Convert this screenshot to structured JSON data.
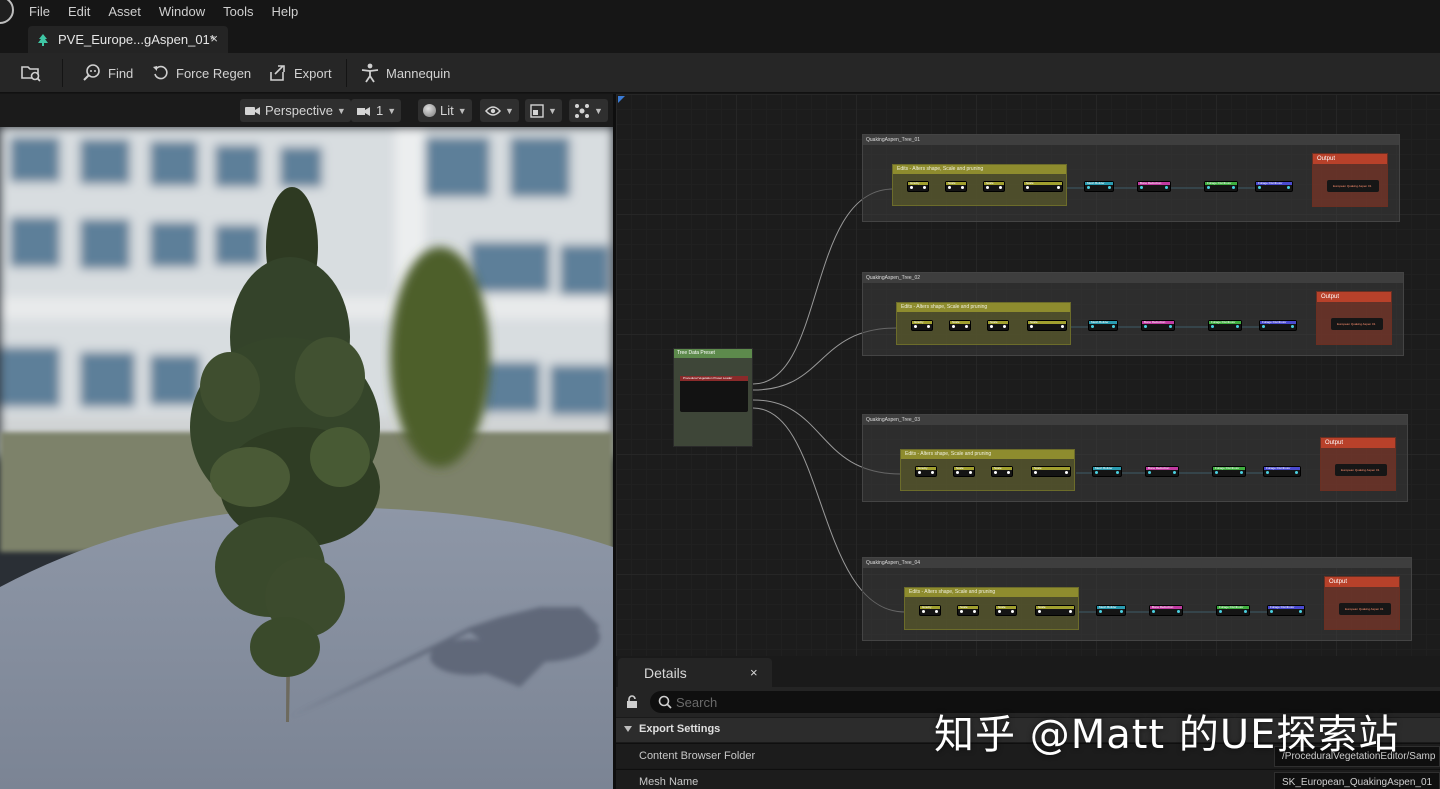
{
  "menu": {
    "items": [
      "File",
      "Edit",
      "Asset",
      "Window",
      "Tools",
      "Help"
    ]
  },
  "tab": {
    "title": "PVE_Europe...gAspen_01*",
    "close": "×"
  },
  "toolbar": {
    "find": "Find",
    "force_regen": "Force Regen",
    "export": "Export",
    "mannequin": "Mannequin"
  },
  "viewport": {
    "perspective": "Perspective",
    "camera_speed": "1",
    "lit": "Lit"
  },
  "graph": {
    "preset_node": {
      "title": "Tree Data Preset",
      "inner": "Procedural Vegetation Preset Loader"
    },
    "comments": [
      {
        "title": "QuakingAspen_Tree_01"
      },
      {
        "title": "QuakingAspen_Tree_02"
      },
      {
        "title": "QuakingAspen_Tree_03"
      },
      {
        "title": "QuakingAspen_Tree_04"
      }
    ],
    "edits_title": "Edits - Alters shape, Scale and pruning",
    "edit_nodes": [
      "Gravity",
      "Scale",
      "Scale",
      "Scale"
    ],
    "chain_nodes": [
      "Mesh Builder",
      "Bone Reduction",
      "Foliage Distributor",
      "Foliage Distributor"
    ],
    "output_title": "Output",
    "output_inner": "European Quaking Aspen 01"
  },
  "details": {
    "title": "Details",
    "close": "×",
    "search_placeholder": "Search",
    "section": "Export Settings",
    "rows": [
      {
        "label": "Content Browser Folder",
        "value": "/ProceduralVegetationEditor/Samp"
      },
      {
        "label": "Mesh Name",
        "value": "SK_European_QuakingAspen_01"
      }
    ]
  },
  "watermark": "知乎 @Matt 的UE探索站",
  "colors": {
    "edits_header": "#8e8c2e",
    "output_header": "#b8412a",
    "preset_header": "#5d8a4c",
    "accent_blue": "#3a7bd5"
  }
}
